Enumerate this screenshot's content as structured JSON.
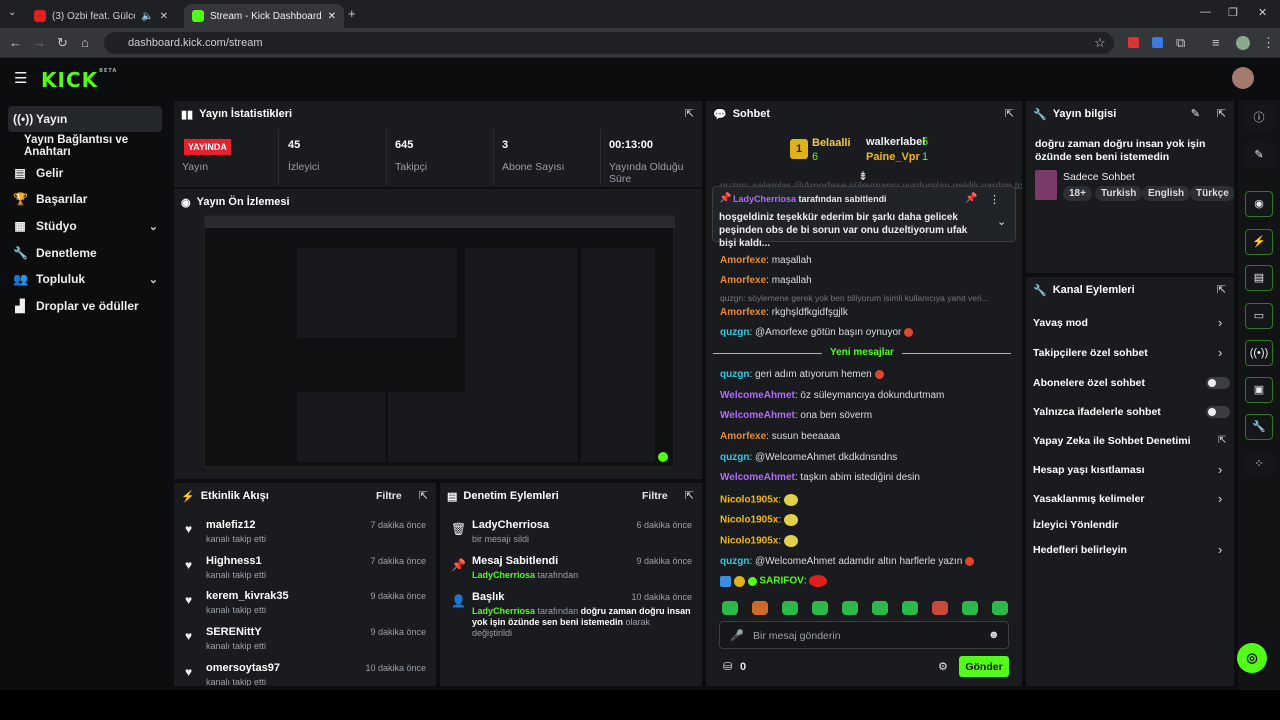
{
  "browser": {
    "tab1": "(3) Ozbi feat. Gülce Duru - 8",
    "tab2": "Stream - Kick Dashboard",
    "url": "dashboard.kick.com/stream"
  },
  "brand": {
    "logo": "KICK",
    "badge": "BETA"
  },
  "sidebar": {
    "items": [
      {
        "label": "Yayın",
        "icon": "broadcast-icon"
      },
      {
        "label": "Yayın Bağlantısı ve Anahtarı",
        "icon": ""
      },
      {
        "label": "Gelir",
        "icon": "money-icon"
      },
      {
        "label": "Başarılar",
        "icon": "trophy-icon"
      },
      {
        "label": "Stüdyo",
        "icon": "studio-icon"
      },
      {
        "label": "Denetleme",
        "icon": "wrench-icon"
      },
      {
        "label": "Topluluk",
        "icon": "community-icon"
      },
      {
        "label": "Droplar ve ödüller",
        "icon": "drops-icon"
      }
    ]
  },
  "stats": {
    "title": "Yayın İstatistikleri",
    "live": "YAYINDA",
    "live_label": "Yayın",
    "viewers": "45",
    "viewers_label": "İzleyici",
    "followers": "645",
    "followers_label": "Takipçi",
    "subs": "3",
    "subs_label": "Abone Sayısı",
    "uptime": "00:13:00",
    "uptime_label": "Yayında Olduğu Süre"
  },
  "preview": {
    "title": "Yayın Ön İzlemesi"
  },
  "activity": {
    "title": "Etkinlik Akışı",
    "filter": "Filtre",
    "items": [
      {
        "user": "malefiz12",
        "text": "kanalı takip etti",
        "time": "7 dakika önce"
      },
      {
        "user": "Highness1",
        "text": "kanalı takip etti",
        "time": "7 dakika önce"
      },
      {
        "user": "kerem_kivrak35",
        "text": "kanalı takip etti",
        "time": "9 dakika önce"
      },
      {
        "user": "SERENittY",
        "text": "kanalı takip etti",
        "time": "9 dakika önce"
      },
      {
        "user": "omersoytas97",
        "text": "kanalı takip etti",
        "time": "10 dakika önce"
      }
    ]
  },
  "moderation": {
    "title": "Denetim Eylemleri",
    "filter": "Filtre",
    "items": [
      {
        "title": "LadyCherriosa",
        "sub": "bir mesajı sildi",
        "time": "6 dakika önce"
      },
      {
        "title": "Mesaj Sabitlendi",
        "sub_user": "LadyCherriosa",
        "sub": "tarafından",
        "time": "9 dakika önce"
      },
      {
        "title": "Başlık",
        "sub_user": "LadyCherriosa",
        "sub": "tarafından",
        "quote": "doğru zaman doğru insan yok işin özünde sen beni istemedin",
        "suffix": "olarak değiştirildi",
        "time": "10 dakika önce"
      }
    ]
  },
  "chat": {
    "title": "Sohbet",
    "gifters": [
      {
        "name": "Belaalli",
        "count": "6"
      },
      {
        "name": "walkerlabel",
        "count": "5"
      },
      {
        "name": "Paine_Vpr",
        "count": "1"
      }
    ],
    "rank": "1",
    "pinned_by": "LadyCherriosa",
    "pinned_suffix": "tarafından sabitlendi",
    "pinned_text": "hoşgeldiniz teşekkür ederim bir şarkı daha gelicek peşinden obs de bi sorun var onu duzeltiyorum ufak bişi kaldı...",
    "faded": "quzgn: selamlar @Amorfexe süleymancı yurdundan geldik yardım topl...",
    "reply_hint": "quzgn: söylemene gerek yok ben biliyorum isimli kullanıcıya yanıt veri...",
    "new_messages": "Yeni mesajlar",
    "messages": [
      {
        "u": "Amorfexe",
        "t": "maşallah",
        "c": "o"
      },
      {
        "u": "Amorfexe",
        "t": "maşallah",
        "c": "o"
      },
      {
        "u": "Amorfexe",
        "t": "rkghşldfkgidfşgjlk",
        "c": "o"
      },
      {
        "u": "quzgn",
        "t": "@Amorfexe götün başın oynuyor",
        "c": "g"
      },
      {
        "u": "quzgn",
        "t": "geri adım atıyorum hemen",
        "c": "g"
      },
      {
        "u": "WelcomeAhmet",
        "t": "öz süleymancıya dokundurtmam",
        "c": "p"
      },
      {
        "u": "WelcomeAhmet",
        "t": "ona ben söverm",
        "c": "p"
      },
      {
        "u": "Amorfexe",
        "t": "susun beeaaaa",
        "c": "o"
      },
      {
        "u": "quzgn",
        "t": "@WelcomeAhmet dkdkdnsndns",
        "c": "g"
      },
      {
        "u": "WelcomeAhmet",
        "t": "taşkın abim istediğini desin",
        "c": "p"
      },
      {
        "u": "Nicolo1905x",
        "t": "",
        "c": "y"
      },
      {
        "u": "Nicolo1905x",
        "t": "",
        "c": "y"
      },
      {
        "u": "Nicolo1905x",
        "t": "",
        "c": "y"
      },
      {
        "u": "quzgn",
        "t": "@WelcomeAhmet adamdır altın harflerle yazın",
        "c": "g"
      },
      {
        "u": "SARIFOV",
        "t": "",
        "c": "g2"
      }
    ],
    "placeholder": "Bir mesaj gönderin",
    "points": "0",
    "send": "Gönder"
  },
  "info": {
    "title": "Yayın bilgisi",
    "stream_title": "doğru zaman doğru insan yok işin özünde sen beni istemedin",
    "category": "Sadece Sohbet",
    "tags": [
      "18+",
      "Turkish",
      "English",
      "Türkçe"
    ]
  },
  "channel_actions": {
    "title": "Kanal Eylemleri",
    "items": [
      {
        "label": "Yavaş mod",
        "ctl": "chev"
      },
      {
        "label": "Takipçilere özel sohbet",
        "ctl": "chev"
      },
      {
        "label": "Abonelere özel sohbet",
        "ctl": "toggle"
      },
      {
        "label": "Yalnızca ifadelerle sohbet",
        "ctl": "toggle"
      },
      {
        "label": "Yapay Zeka ile Sohbet Denetimi",
        "ctl": "ext"
      },
      {
        "label": "Hesap yaşı kısıtlaması",
        "ctl": "chev"
      },
      {
        "label": "Yasaklanmış kelimeler",
        "ctl": "chev"
      },
      {
        "label": "İzleyici Yönlendir",
        "ctl": ""
      },
      {
        "label": "Hedefleri belirleyin",
        "ctl": "chev"
      }
    ]
  },
  "colors": {
    "accent": "#53fc18",
    "live": "#e5212e",
    "panel": "#191b1f"
  }
}
